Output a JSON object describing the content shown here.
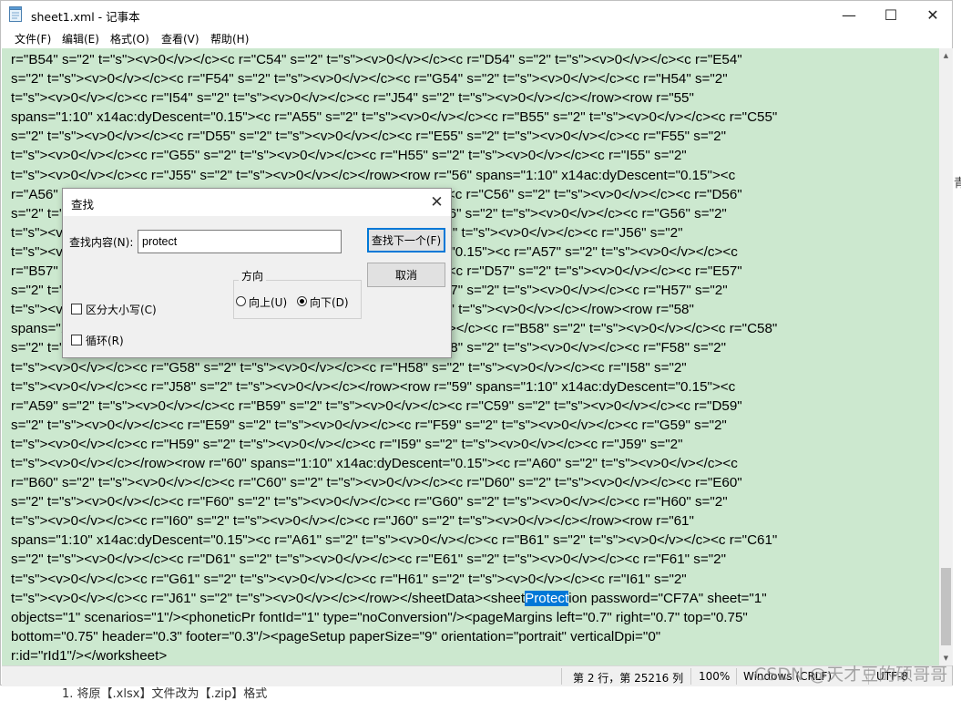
{
  "window": {
    "title": "sheet1.xml - 记事本",
    "controls": {
      "minimize": "—",
      "maximize": "☐",
      "close": "✕"
    }
  },
  "menu": [
    {
      "label": "文件(F)"
    },
    {
      "label": "编辑(E)"
    },
    {
      "label": "格式(O)"
    },
    {
      "label": "查看(V)"
    },
    {
      "label": "帮助(H)"
    }
  ],
  "editor": {
    "lines": [
      "r=\"B54\" s=\"2\" t=\"s\"><v>0</v></c><c r=\"C54\" s=\"2\" t=\"s\"><v>0</v></c><c r=\"D54\" s=\"2\" t=\"s\"><v>0</v></c><c r=\"E54\"",
      "s=\"2\" t=\"s\"><v>0</v></c><c r=\"F54\" s=\"2\" t=\"s\"><v>0</v></c><c r=\"G54\" s=\"2\" t=\"s\"><v>0</v></c><c r=\"H54\" s=\"2\"",
      "t=\"s\"><v>0</v></c><c r=\"I54\" s=\"2\" t=\"s\"><v>0</v></c><c r=\"J54\" s=\"2\" t=\"s\"><v>0</v></c></row><row r=\"55\"",
      "spans=\"1:10\" x14ac:dyDescent=\"0.15\"><c r=\"A55\" s=\"2\" t=\"s\"><v>0</v></c><c r=\"B55\" s=\"2\" t=\"s\"><v>0</v></c><c r=\"C55\"",
      "s=\"2\" t=\"s\"><v>0</v></c><c r=\"D55\" s=\"2\" t=\"s\"><v>0</v></c><c r=\"E55\" s=\"2\" t=\"s\"><v>0</v></c><c r=\"F55\" s=\"2\"",
      "t=\"s\"><v>0</v></c><c r=\"G55\" s=\"2\" t=\"s\"><v>0</v></c><c r=\"H55\" s=\"2\" t=\"s\"><v>0</v></c><c r=\"I55\" s=\"2\"",
      "t=\"s\"><v>0</v></c><c r=\"J55\" s=\"2\" t=\"s\"><v>0</v></c></row><row r=\"56\" spans=\"1:10\" x14ac:dyDescent=\"0.15\"><c",
      "r=\"A56\" s=\"2\" t=\"s\"><v>0</v></c><c r=\"B56\" s=\"2\" t=\"s\"><v>0</v></c><c r=\"C56\" s=\"2\" t=\"s\"><v>0</v></c><c r=\"D56\"",
      "s=\"2\" t=\"s\"><v>0</v></c><c r=\"E56\" s=\"2\" t=\"s\"><v>0</v></c><c r=\"F56\" s=\"2\" t=\"s\"><v>0</v></c><c r=\"G56\" s=\"2\"",
      "t=\"s\"><v>0</v></c><c r=\"H56\" s=\"2\" t=\"s\"><v>0</v></c><c r=\"I56\" s=\"2\" t=\"s\"><v>0</v></c><c r=\"J56\" s=\"2\"",
      "t=\"s\"><v>0</v></c></row><row r=\"57\" spans=\"1:10\" x14ac:dyDescent=\"0.15\"><c r=\"A57\" s=\"2\" t=\"s\"><v>0</v></c><c",
      "r=\"B57\" s=\"2\" t=\"s\"><v>0</v></c><c r=\"C57\" s=\"2\" t=\"s\"><v>0</v></c><c r=\"D57\" s=\"2\" t=\"s\"><v>0</v></c><c r=\"E57\"",
      "s=\"2\" t=\"s\"><v>0</v></c><c r=\"F57\" s=\"2\" t=\"s\"><v>0</v></c><c r=\"G57\" s=\"2\" t=\"s\"><v>0</v></c><c r=\"H57\" s=\"2\"",
      "t=\"s\"><v>0</v></c><c r=\"I57\" s=\"2\" t=\"s\"><v>0</v></c><c r=\"J57\" s=\"2\" t=\"s\"><v>0</v></c></row><row r=\"58\"",
      "spans=\"1:10\" x14ac:dyDescent=\"0.15\"><c r=\"A58\" s=\"2\" t=\"s\"><v>0</v></c><c r=\"B58\" s=\"2\" t=\"s\"><v>0</v></c><c r=\"C58\"",
      "s=\"2\" t=\"s\"><v>0</v></c><c r=\"D58\" s=\"2\" t=\"s\"><v>0</v></c><c r=\"E58\" s=\"2\" t=\"s\"><v>0</v></c><c r=\"F58\" s=\"2\"",
      "t=\"s\"><v>0</v></c><c r=\"G58\" s=\"2\" t=\"s\"><v>0</v></c><c r=\"H58\" s=\"2\" t=\"s\"><v>0</v></c><c r=\"I58\" s=\"2\"",
      "t=\"s\"><v>0</v></c><c r=\"J58\" s=\"2\" t=\"s\"><v>0</v></c></row><row r=\"59\" spans=\"1:10\" x14ac:dyDescent=\"0.15\"><c",
      "r=\"A59\" s=\"2\" t=\"s\"><v>0</v></c><c r=\"B59\" s=\"2\" t=\"s\"><v>0</v></c><c r=\"C59\" s=\"2\" t=\"s\"><v>0</v></c><c r=\"D59\"",
      "s=\"2\" t=\"s\"><v>0</v></c><c r=\"E59\" s=\"2\" t=\"s\"><v>0</v></c><c r=\"F59\" s=\"2\" t=\"s\"><v>0</v></c><c r=\"G59\" s=\"2\"",
      "t=\"s\"><v>0</v></c><c r=\"H59\" s=\"2\" t=\"s\"><v>0</v></c><c r=\"I59\" s=\"2\" t=\"s\"><v>0</v></c><c r=\"J59\" s=\"2\"",
      "t=\"s\"><v>0</v></c></row><row r=\"60\" spans=\"1:10\" x14ac:dyDescent=\"0.15\"><c r=\"A60\" s=\"2\" t=\"s\"><v>0</v></c><c",
      "r=\"B60\" s=\"2\" t=\"s\"><v>0</v></c><c r=\"C60\" s=\"2\" t=\"s\"><v>0</v></c><c r=\"D60\" s=\"2\" t=\"s\"><v>0</v></c><c r=\"E60\"",
      "s=\"2\" t=\"s\"><v>0</v></c><c r=\"F60\" s=\"2\" t=\"s\"><v>0</v></c><c r=\"G60\" s=\"2\" t=\"s\"><v>0</v></c><c r=\"H60\" s=\"2\"",
      "t=\"s\"><v>0</v></c><c r=\"I60\" s=\"2\" t=\"s\"><v>0</v></c><c r=\"J60\" s=\"2\" t=\"s\"><v>0</v></c></row><row r=\"61\"",
      "spans=\"1:10\" x14ac:dyDescent=\"0.15\"><c r=\"A61\" s=\"2\" t=\"s\"><v>0</v></c><c r=\"B61\" s=\"2\" t=\"s\"><v>0</v></c><c r=\"C61\"",
      "s=\"2\" t=\"s\"><v>0</v></c><c r=\"D61\" s=\"2\" t=\"s\"><v>0</v></c><c r=\"E61\" s=\"2\" t=\"s\"><v>0</v></c><c r=\"F61\" s=\"2\"",
      "t=\"s\"><v>0</v></c><c r=\"G61\" s=\"2\" t=\"s\"><v>0</v></c><c r=\"H61\" s=\"2\" t=\"s\"><v>0</v></c><c r=\"I61\" s=\"2\"",
      "t=\"s\"><v>0</v></c><c r=\"J61\" s=\"2\" t=\"s\"><v>0</v></c></row></sheetData><sheetProtection password=\"CF7A\" sheet=\"1\"",
      "objects=\"1\" scenarios=\"1\"/><phoneticPr fontId=\"1\" type=\"noConversion\"/><pageMargins left=\"0.7\" right=\"0.7\" top=\"0.75\"",
      "bottom=\"0.75\" header=\"0.3\" footer=\"0.3\"/><pageSetup paperSize=\"9\" orientation=\"portrait\" verticalDpi=\"0\"",
      "r:id=\"rId1\"/></worksheet>"
    ],
    "highlight": {
      "line": 28,
      "text": "Protect"
    }
  },
  "status": {
    "position": "第 2 行，第 25216 列",
    "zoom": "100%",
    "line_ending": "Windows (CRLF)",
    "encoding": "UTF-8"
  },
  "find_dialog": {
    "title": "查找",
    "close": "✕",
    "label": "查找内容(N):",
    "value": "protect",
    "find_next": "查找下一个(F)",
    "cancel": "取消",
    "direction_label": "方向",
    "up": "向上(U)",
    "down": "向下(D)",
    "selected_direction": "down",
    "match_case": "区分大小写(C)",
    "match_case_checked": false,
    "wrap": "循环(R)",
    "wrap_checked": false
  },
  "watermark": "CSDN @天才豆的硕哥哥",
  "background_text": "1. 将原【.xlsx】文件改为【.zip】格式",
  "background_side_char": "青",
  "colors": {
    "editor_bg": "#cce8cf",
    "selection": "#0078d7"
  }
}
